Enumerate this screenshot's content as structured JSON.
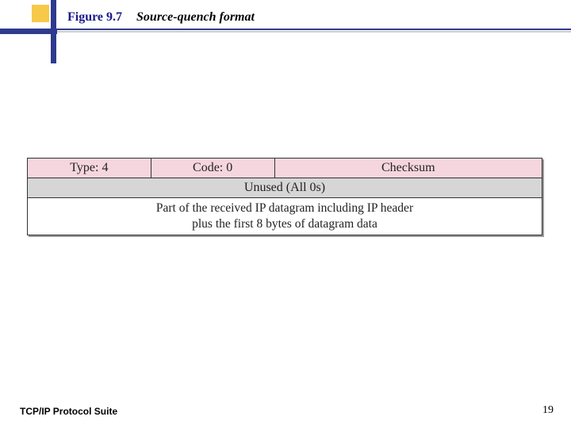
{
  "header": {
    "figure_number": "Figure 9.7",
    "figure_title": "Source-quench format"
  },
  "diagram": {
    "row1": {
      "type": "Type: 4",
      "code": "Code: 0",
      "checksum": "Checksum"
    },
    "row2": "Unused (All 0s)",
    "row3_line1": "Part of the received IP datagram including IP header",
    "row3_line2": "plus the first 8 bytes of datagram data"
  },
  "footer": {
    "suite": "TCP/IP Protocol Suite",
    "page": "19"
  }
}
